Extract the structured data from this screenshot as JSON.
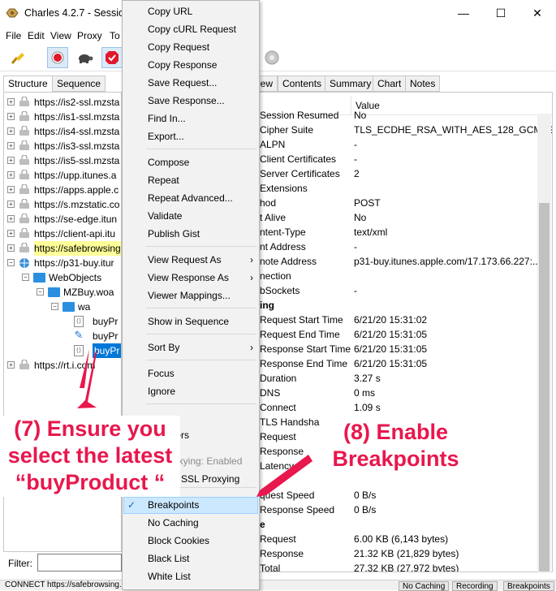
{
  "window": {
    "title": "Charles 4.2.7 - Session",
    "min": "—",
    "max": "☐",
    "close": "✕"
  },
  "menubar": [
    "File",
    "Edit",
    "View",
    "Proxy",
    "To"
  ],
  "toolbar": {
    "icons": [
      "broom-icon",
      "record-icon",
      "turtle-icon",
      "breakpoint-icon",
      "settings-icon"
    ]
  },
  "left_tabs": [
    "Structure",
    "Sequence"
  ],
  "tree": [
    {
      "label": "https://is2-ssl.mzsta",
      "level": 0,
      "expander": "+"
    },
    {
      "label": "https://is1-ssl.mzsta",
      "level": 0,
      "expander": "+"
    },
    {
      "label": "https://is4-ssl.mzsta",
      "level": 0,
      "expander": "+"
    },
    {
      "label": "https://is3-ssl.mzsta",
      "level": 0,
      "expander": "+"
    },
    {
      "label": "https://is5-ssl.mzsta",
      "level": 0,
      "expander": "+"
    },
    {
      "label": "https://upp.itunes.a",
      "level": 0,
      "expander": "+"
    },
    {
      "label": "https://apps.apple.c",
      "level": 0,
      "expander": "+"
    },
    {
      "label": "https://s.mzstatic.co",
      "level": 0,
      "expander": "+"
    },
    {
      "label": "https://se-edge.itun",
      "level": 0,
      "expander": "+"
    },
    {
      "label": "https://client-api.itu",
      "level": 0,
      "expander": "+"
    },
    {
      "label": "https://safebrowsing",
      "level": 0,
      "expander": "+",
      "highlight": true
    },
    {
      "label": "https://p31-buy.itur",
      "level": 0,
      "expander": "−",
      "globe": true
    },
    {
      "label": "WebObjects",
      "level": 1,
      "expander": "−",
      "folder": true
    },
    {
      "label": "MZBuy.woa",
      "level": 2,
      "expander": "−",
      "folder": true
    },
    {
      "label": "wa",
      "level": 3,
      "expander": "−",
      "folder": true
    },
    {
      "label": "buyPr",
      "level": 4,
      "doc": true
    },
    {
      "label": "buyPr",
      "level": 4,
      "doc": true,
      "pen": true
    },
    {
      "label": "buyPr",
      "level": 4,
      "doc": true,
      "selected": true
    },
    {
      "label": "https://rt.i",
      "suffix": ".com",
      "level": 0,
      "expander": "+"
    }
  ],
  "right_tabs": [
    "Overview",
    "Contents",
    "Summary",
    "Chart",
    "Notes"
  ],
  "right_tab_visible": "ew",
  "value_header": "Value",
  "kv": [
    [
      "Session Resumed",
      "No"
    ],
    [
      "Cipher Suite",
      "TLS_ECDHE_RSA_WITH_AES_128_GCM_S..."
    ],
    [
      "ALPN",
      "-"
    ],
    [
      "Client Certificates",
      "-"
    ],
    [
      "Server Certificates",
      "2"
    ],
    [
      "Extensions",
      ""
    ],
    [
      "hod",
      "POST"
    ],
    [
      "t Alive",
      "No"
    ],
    [
      "ntent-Type",
      "text/xml"
    ],
    [
      "nt Address",
      "-"
    ],
    [
      "note Address",
      "p31-buy.itunes.apple.com/17.173.66.227:..."
    ],
    [
      "nection",
      ""
    ],
    [
      "bSockets",
      "-"
    ],
    [
      "ing",
      ""
    ],
    [
      "Request Start Time",
      "6/21/20 15:31:02"
    ],
    [
      "Request End Time",
      "6/21/20 15:31:05"
    ],
    [
      "Response Start Time",
      "6/21/20 15:31:05"
    ],
    [
      "Response End Time",
      "6/21/20 15:31:05"
    ],
    [
      "Duration",
      "3.27 s"
    ],
    [
      "DNS",
      "0 ms"
    ],
    [
      "Connect",
      "1.09 s"
    ],
    [
      "TLS Handsha",
      ""
    ],
    [
      "Request",
      ""
    ],
    [
      "Response",
      ""
    ],
    [
      "Latency",
      ""
    ],
    [
      "",
      ""
    ],
    [
      "quest Speed",
      "0 B/s"
    ],
    [
      "Response Speed",
      "0 B/s"
    ],
    [
      "e",
      ""
    ],
    [
      "Request",
      "6.00 KB (6,143 bytes)"
    ],
    [
      "Response",
      "21.32 KB (21,829 bytes)"
    ],
    [
      "Total",
      "27.32 KB (27,972 bytes)"
    ]
  ],
  "context_menu": {
    "items": [
      "Copy URL",
      "Copy cURL Request",
      "Copy Request",
      "Copy Response",
      "Save Request...",
      "Save Response...",
      "Find In...",
      "Export...",
      "Compose",
      "Repeat",
      "Repeat Advanced...",
      "Validate",
      "Publish Gist",
      "View Request As",
      "View Response As",
      "Viewer Mappings...",
      "Show in Sequence",
      "Sort By",
      "Focus",
      "Ignore",
      "Others",
      "oxying: Enabled",
      "e SSL Proxying",
      "Breakpoints",
      "No Caching",
      "Block Cookies",
      "Black List",
      "White List"
    ],
    "checked_item": "Breakpoints",
    "check_mark": "✓",
    "submenu_arrow": "›"
  },
  "filter_label": "Filter:",
  "status": {
    "text": "CONNECT https://safebrowsing.g",
    "buttons": [
      "No Caching",
      "Recording",
      "Breakpoints"
    ]
  },
  "annotations": {
    "left": "(7) Ensure you select the latest “buyProduct “",
    "right": "(8) Enable Breakpoints"
  },
  "colors": {
    "annotation": "#e8174d",
    "highlight": "#cce8ff",
    "selected": "#0078d7",
    "yellow": "#ffff99"
  }
}
